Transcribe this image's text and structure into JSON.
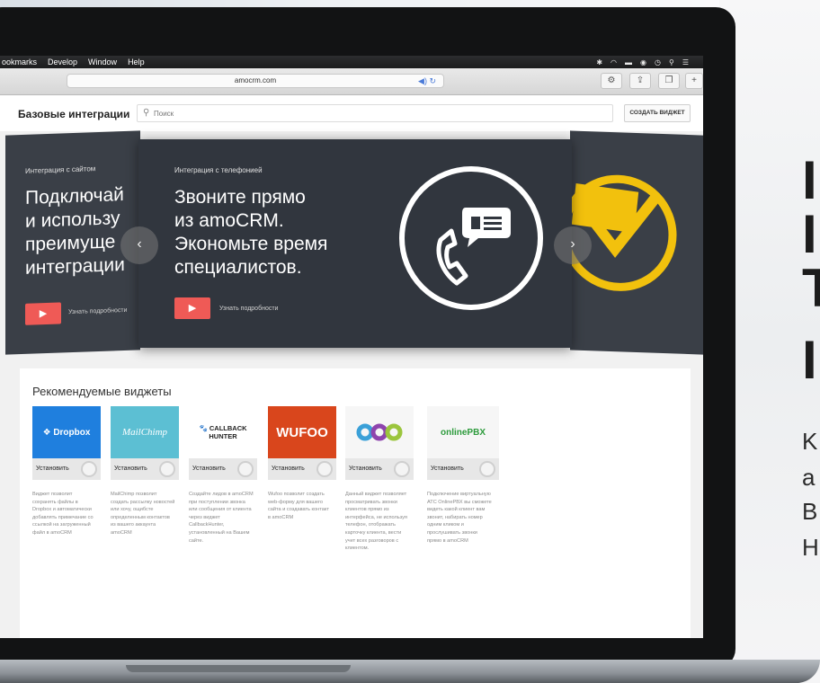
{
  "menubar": {
    "items": [
      "ookmarks",
      "Develop",
      "Window",
      "Help"
    ]
  },
  "browser": {
    "url": "amocrm.com"
  },
  "app": {
    "title": "Базовые интеграции",
    "search_placeholder": "Поиск",
    "create_widget_label": "СОЗДАТЬ ВИДЖЕТ"
  },
  "carousel": {
    "left_slide": {
      "kicker": "Интеграция с сайтом",
      "headline": "Подключай\nи использу\nпреимуще\nинтеграции",
      "more_label": "Узнать подробности"
    },
    "main_slide": {
      "kicker": "Интеграция с телефонией",
      "headline": "Звоните прямо\nиз amoCRM.\nЭкономьте время\nспециалистов.",
      "more_label": "Узнать подробности"
    },
    "prev_glyph": "‹",
    "next_glyph": "›"
  },
  "widgets": {
    "title": "Рекомендуемые виджеты",
    "install_label": "Установить",
    "items": [
      {
        "name": "Dropbox",
        "logo_bg": "#1f7fde",
        "logo_color": "#ffffff",
        "description": "Виджет позволит сохранять файлы в Dropbox и автоматически добавлять примечание со ссылкой на загруженный файл в amoCRM"
      },
      {
        "name": "MailChimp",
        "logo_bg": "#5cbfd3",
        "logo_color": "#ffffff",
        "description": "MailChimp позволит создать рассылку новостей или хочу, ощибсте определенным контактов из вашего аккаунта amoCRM"
      },
      {
        "name": "CALLBACK HUNTER",
        "logo_bg": "#ffffff",
        "logo_color": "#1e1e1e",
        "description": "Создайте лидов в amoCRM при поступлении звонка или сообщения от клиента через виджет CallbackHunter, установленный на Вашем сайте."
      },
      {
        "name": "WUFOO",
        "logo_bg": "#d9461c",
        "logo_color": "#ffffff",
        "description": "Wufoo позволит создать web-форму для вашего сайта и создавать контакт в amoCRM"
      },
      {
        "name": "OOO",
        "logo_bg": "#f6f6f6",
        "logo_color": "#3aa0d8",
        "description": "Данный виджет позволяет просматривать звонки клиентов прямо из интерфейса, не используя телефон, отображать карточку клиента, вести учет всех разговоров с клиентом."
      },
      {
        "name": "onlinePBX",
        "logo_bg": "#f6f6f6",
        "logo_color": "#2d9b3c",
        "description": "Подключение виртуальную АТС OnlinePBX вы сможете видеть какой клиент вам звонит, набирать номер одним кликом и прослушивать звонки прямо в amoCRM"
      }
    ]
  },
  "background": {
    "big_letters": [
      "I",
      "I",
      "T",
      "I"
    ],
    "small_letters": [
      "K",
      "a",
      "B",
      "H"
    ]
  }
}
